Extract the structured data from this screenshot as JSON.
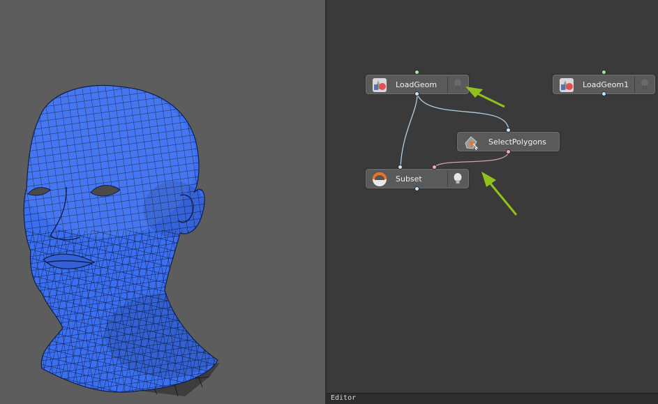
{
  "viewport": {
    "background": "#5d5d5d",
    "mesh_color": "#3b6ff0",
    "subject": "wireframe-head-mesh"
  },
  "editor": {
    "background": "#3a3a3a",
    "status_label": "Editor",
    "nodes": {
      "loadgeom": {
        "label": "LoadGeom",
        "icon": "loadgeom-icon",
        "bulb_state": "off"
      },
      "loadgeom1": {
        "label": "LoadGeom1",
        "icon": "loadgeom-icon",
        "bulb_state": "off"
      },
      "selectpolygons": {
        "label": "SelectPolygons",
        "icon": "selectpolygons-icon"
      },
      "subset": {
        "label": "Subset",
        "icon": "subset-icon",
        "bulb_state": "on"
      }
    },
    "port_colors": {
      "input_top": "#9fe8a8",
      "output": "#bfe6ff",
      "selection": "#f4a9b8"
    },
    "wire_colors": {
      "geometry": "#b4cee0",
      "selection": "#d9a0a8"
    },
    "annotation_color": "#8fc21a"
  }
}
